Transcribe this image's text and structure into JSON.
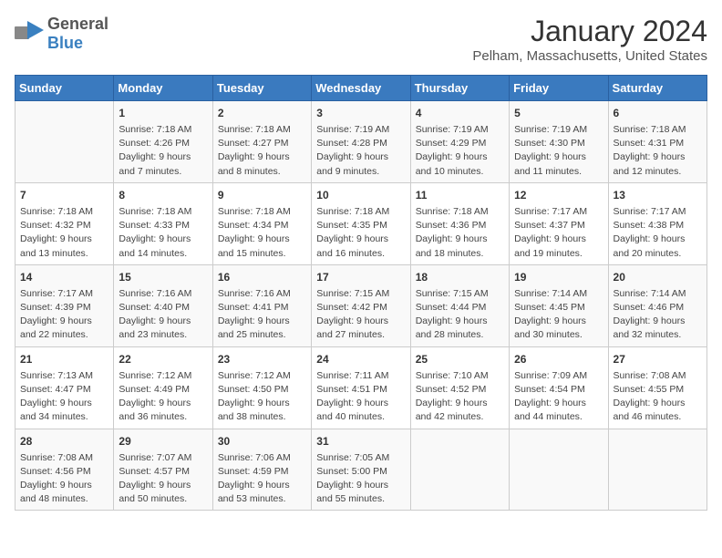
{
  "header": {
    "logo_line1": "General",
    "logo_line2": "Blue",
    "month": "January 2024",
    "location": "Pelham, Massachusetts, United States"
  },
  "weekdays": [
    "Sunday",
    "Monday",
    "Tuesday",
    "Wednesday",
    "Thursday",
    "Friday",
    "Saturday"
  ],
  "weeks": [
    [
      {
        "day": "",
        "info": ""
      },
      {
        "day": "1",
        "info": "Sunrise: 7:18 AM\nSunset: 4:26 PM\nDaylight: 9 hours\nand 7 minutes."
      },
      {
        "day": "2",
        "info": "Sunrise: 7:18 AM\nSunset: 4:27 PM\nDaylight: 9 hours\nand 8 minutes."
      },
      {
        "day": "3",
        "info": "Sunrise: 7:19 AM\nSunset: 4:28 PM\nDaylight: 9 hours\nand 9 minutes."
      },
      {
        "day": "4",
        "info": "Sunrise: 7:19 AM\nSunset: 4:29 PM\nDaylight: 9 hours\nand 10 minutes."
      },
      {
        "day": "5",
        "info": "Sunrise: 7:19 AM\nSunset: 4:30 PM\nDaylight: 9 hours\nand 11 minutes."
      },
      {
        "day": "6",
        "info": "Sunrise: 7:18 AM\nSunset: 4:31 PM\nDaylight: 9 hours\nand 12 minutes."
      }
    ],
    [
      {
        "day": "7",
        "info": "Sunrise: 7:18 AM\nSunset: 4:32 PM\nDaylight: 9 hours\nand 13 minutes."
      },
      {
        "day": "8",
        "info": "Sunrise: 7:18 AM\nSunset: 4:33 PM\nDaylight: 9 hours\nand 14 minutes."
      },
      {
        "day": "9",
        "info": "Sunrise: 7:18 AM\nSunset: 4:34 PM\nDaylight: 9 hours\nand 15 minutes."
      },
      {
        "day": "10",
        "info": "Sunrise: 7:18 AM\nSunset: 4:35 PM\nDaylight: 9 hours\nand 16 minutes."
      },
      {
        "day": "11",
        "info": "Sunrise: 7:18 AM\nSunset: 4:36 PM\nDaylight: 9 hours\nand 18 minutes."
      },
      {
        "day": "12",
        "info": "Sunrise: 7:17 AM\nSunset: 4:37 PM\nDaylight: 9 hours\nand 19 minutes."
      },
      {
        "day": "13",
        "info": "Sunrise: 7:17 AM\nSunset: 4:38 PM\nDaylight: 9 hours\nand 20 minutes."
      }
    ],
    [
      {
        "day": "14",
        "info": "Sunrise: 7:17 AM\nSunset: 4:39 PM\nDaylight: 9 hours\nand 22 minutes."
      },
      {
        "day": "15",
        "info": "Sunrise: 7:16 AM\nSunset: 4:40 PM\nDaylight: 9 hours\nand 23 minutes."
      },
      {
        "day": "16",
        "info": "Sunrise: 7:16 AM\nSunset: 4:41 PM\nDaylight: 9 hours\nand 25 minutes."
      },
      {
        "day": "17",
        "info": "Sunrise: 7:15 AM\nSunset: 4:42 PM\nDaylight: 9 hours\nand 27 minutes."
      },
      {
        "day": "18",
        "info": "Sunrise: 7:15 AM\nSunset: 4:44 PM\nDaylight: 9 hours\nand 28 minutes."
      },
      {
        "day": "19",
        "info": "Sunrise: 7:14 AM\nSunset: 4:45 PM\nDaylight: 9 hours\nand 30 minutes."
      },
      {
        "day": "20",
        "info": "Sunrise: 7:14 AM\nSunset: 4:46 PM\nDaylight: 9 hours\nand 32 minutes."
      }
    ],
    [
      {
        "day": "21",
        "info": "Sunrise: 7:13 AM\nSunset: 4:47 PM\nDaylight: 9 hours\nand 34 minutes."
      },
      {
        "day": "22",
        "info": "Sunrise: 7:12 AM\nSunset: 4:49 PM\nDaylight: 9 hours\nand 36 minutes."
      },
      {
        "day": "23",
        "info": "Sunrise: 7:12 AM\nSunset: 4:50 PM\nDaylight: 9 hours\nand 38 minutes."
      },
      {
        "day": "24",
        "info": "Sunrise: 7:11 AM\nSunset: 4:51 PM\nDaylight: 9 hours\nand 40 minutes."
      },
      {
        "day": "25",
        "info": "Sunrise: 7:10 AM\nSunset: 4:52 PM\nDaylight: 9 hours\nand 42 minutes."
      },
      {
        "day": "26",
        "info": "Sunrise: 7:09 AM\nSunset: 4:54 PM\nDaylight: 9 hours\nand 44 minutes."
      },
      {
        "day": "27",
        "info": "Sunrise: 7:08 AM\nSunset: 4:55 PM\nDaylight: 9 hours\nand 46 minutes."
      }
    ],
    [
      {
        "day": "28",
        "info": "Sunrise: 7:08 AM\nSunset: 4:56 PM\nDaylight: 9 hours\nand 48 minutes."
      },
      {
        "day": "29",
        "info": "Sunrise: 7:07 AM\nSunset: 4:57 PM\nDaylight: 9 hours\nand 50 minutes."
      },
      {
        "day": "30",
        "info": "Sunrise: 7:06 AM\nSunset: 4:59 PM\nDaylight: 9 hours\nand 53 minutes."
      },
      {
        "day": "31",
        "info": "Sunrise: 7:05 AM\nSunset: 5:00 PM\nDaylight: 9 hours\nand 55 minutes."
      },
      {
        "day": "",
        "info": ""
      },
      {
        "day": "",
        "info": ""
      },
      {
        "day": "",
        "info": ""
      }
    ]
  ]
}
